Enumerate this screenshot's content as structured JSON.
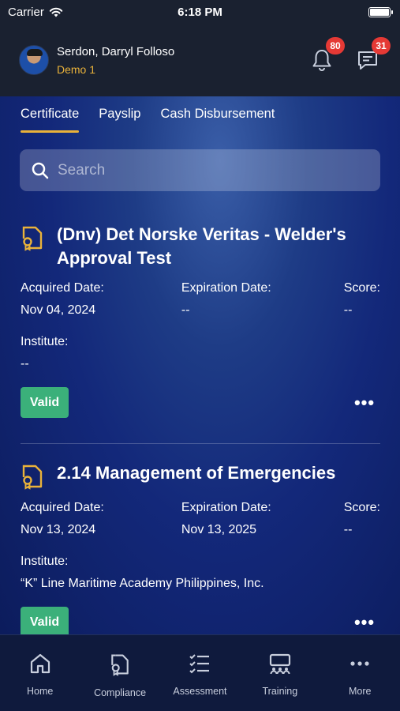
{
  "status": {
    "carrier": "Carrier",
    "time": "6:18 PM"
  },
  "header": {
    "name": "Serdon, Darryl Folloso",
    "subtitle": "Demo 1",
    "notifications_count": "80",
    "messages_count": "31"
  },
  "tabs": [
    {
      "label": "Certificate",
      "active": true
    },
    {
      "label": "Payslip",
      "active": false
    },
    {
      "label": "Cash Disbursement",
      "active": false
    }
  ],
  "search": {
    "placeholder": "Search",
    "value": ""
  },
  "certificates": [
    {
      "title": "(Dnv) Det Norske Veritas - Welder's Approval Test",
      "acquired_label": "Acquired Date:",
      "acquired": "Nov 04, 2024",
      "expiration_label": "Expiration Date:",
      "expiration": "--",
      "score_label": "Score:",
      "score": "--",
      "institute_label": "Institute:",
      "institute": "--",
      "status": "Valid"
    },
    {
      "title": "2.14 Management of Emergencies",
      "acquired_label": "Acquired Date:",
      "acquired": "Nov 13, 2024",
      "expiration_label": "Expiration Date:",
      "expiration": "Nov 13, 2025",
      "score_label": "Score:",
      "score": "--",
      "institute_label": "Institute:",
      "institute": "“K” Line Maritime Academy Philippines, Inc.",
      "status": "Valid"
    }
  ],
  "more_glyph": "•••",
  "bottom_nav": [
    {
      "label": "Home",
      "icon": "home-icon"
    },
    {
      "label": "Compliance",
      "icon": "certificate-icon"
    },
    {
      "label": "Assessment",
      "icon": "checklist-icon"
    },
    {
      "label": "Training",
      "icon": "classroom-icon"
    },
    {
      "label": "More",
      "icon": "more-icon"
    }
  ],
  "colors": {
    "accent": "#e9b23a",
    "valid": "#3bb07a",
    "badge": "#e53935"
  }
}
